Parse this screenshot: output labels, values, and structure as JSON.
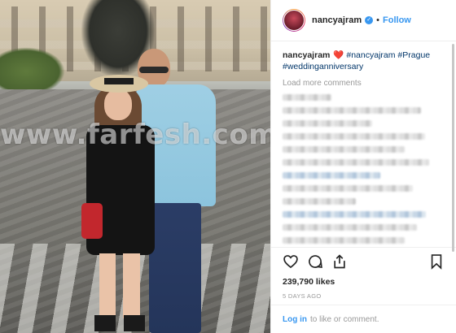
{
  "photo": {
    "watermark": "www.farfesh.com"
  },
  "header": {
    "username": "nancyajram",
    "verified_glyph": "✓",
    "separator": "•",
    "follow_label": "Follow"
  },
  "caption": {
    "username": "nancyajram",
    "emoji": "❤️",
    "tag_1": "#nancyajram",
    "tag_2": "#Prague",
    "tag_3": "#weddinganniversary"
  },
  "comments": {
    "load_more_label": "Load more comments"
  },
  "actions": {
    "like_icon": "heart-icon",
    "comment_icon": "comment-icon",
    "share_icon": "share-icon",
    "save_icon": "bookmark-icon"
  },
  "stats": {
    "likes_count": "239,790",
    "likes_label": "likes",
    "posted_ago": "5 DAYS AGO"
  },
  "footer": {
    "login_label": "Log in",
    "login_suffix": "to like or comment."
  },
  "colors": {
    "link_blue": "#3897f0",
    "hashtag_blue": "#003569",
    "muted_gray": "#999999",
    "text_dark": "#262626"
  }
}
